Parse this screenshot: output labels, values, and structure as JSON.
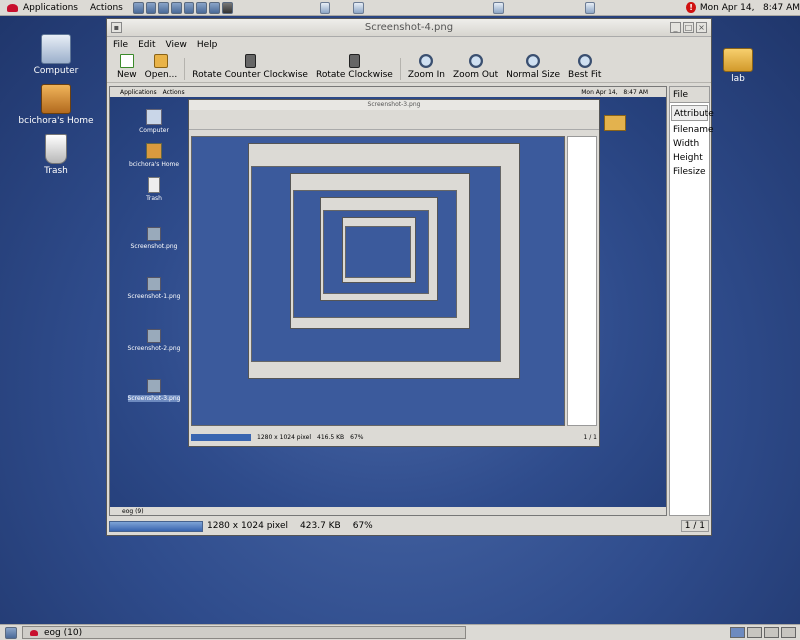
{
  "top_panel": {
    "applications": "Applications",
    "actions": "Actions",
    "datetime": "Mon Apr 14,   8:47 AM"
  },
  "desktop": {
    "computer": "Computer",
    "home": "bcichora's Home",
    "trash": "Trash",
    "lab": "lab"
  },
  "window": {
    "title": "Screenshot-4.png",
    "menu": [
      "File",
      "Edit",
      "View",
      "Help"
    ],
    "toolbar": [
      "New",
      "Open...",
      "Rotate Counter Clockwise",
      "Rotate Clockwise",
      "Zoom In",
      "Zoom Out",
      "Normal Size",
      "Best Fit"
    ],
    "side": {
      "tab": "File",
      "header": "Attribute",
      "rows": [
        "Filename",
        "Width",
        "Height",
        "Filesize"
      ]
    },
    "status": {
      "dimensions": "1280 x 1024 pixel",
      "size": "423.7 KB",
      "zoom": "67%",
      "page": "1 / 1"
    }
  },
  "inner": {
    "applications": "Applications",
    "actions": "Actions",
    "datetime": "Mon Apr 14,   8:47 AM",
    "computer": "Computer",
    "home": "bcichora's Home",
    "trash": "Trash",
    "screenshots": [
      "Screenshot.png",
      "Screenshot-1.png",
      "Screenshot-2.png",
      "Screenshot-3.png"
    ],
    "taskbar": "eog (9)",
    "window_title": "Screenshot-3.png",
    "status": {
      "dimensions": "1280 x 1024 pixel",
      "size": "416.5 KB",
      "zoom": "67%",
      "page": "1 / 1"
    }
  },
  "bottom_panel": {
    "task": "eog (10)"
  },
  "colors": {
    "desktop": "#2f4c8c",
    "panel": "#dcdad5",
    "selection": "#3965b0"
  }
}
